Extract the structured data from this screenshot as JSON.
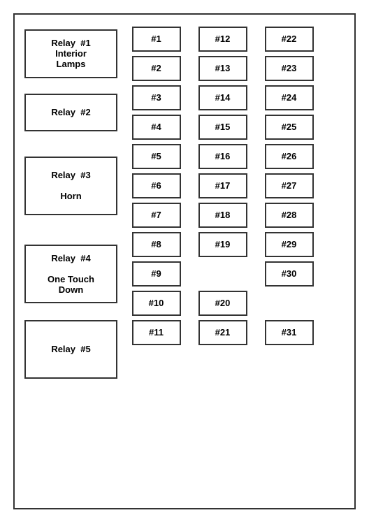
{
  "relays": [
    {
      "id": "relay1",
      "label": "Relay  #1\nInterior\nLamps"
    },
    {
      "id": "relay2",
      "label": "Relay  #2"
    },
    {
      "id": "relay3",
      "label": "Relay  #3\nHorn"
    },
    {
      "id": "relay4",
      "label": "Relay  #4\nOne Touch\nDown"
    },
    {
      "id": "relay5",
      "label": "Relay  #5"
    }
  ],
  "fuses": {
    "col1": [
      "#1",
      "#2",
      "#3",
      "#4",
      "#5",
      "#6",
      "#7",
      "#8",
      "#9",
      "#10",
      "#11"
    ],
    "col2": [
      "#12",
      "#13",
      "#14",
      "#15",
      "#16",
      "#17",
      "#18",
      "#19",
      "",
      "#20",
      "#21"
    ],
    "col3": [
      "#22",
      "#23",
      "#24",
      "#25",
      "#26",
      "#27",
      "#28",
      "#29",
      "#30",
      "",
      "#31"
    ]
  }
}
